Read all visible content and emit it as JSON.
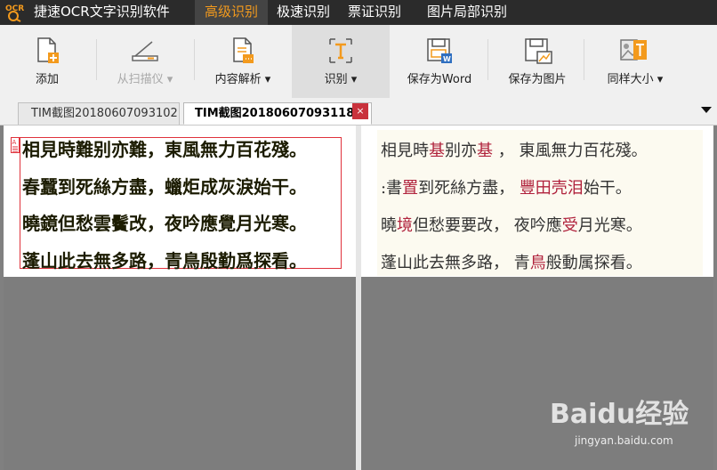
{
  "app": {
    "title": "捷速OCR文字识别软件",
    "logo_text": "OCR"
  },
  "menu_tabs": [
    {
      "label": "高级识别",
      "active": true
    },
    {
      "label": "极速识别",
      "active": false
    },
    {
      "label": "票证识别",
      "active": false
    },
    {
      "label": "图片局部识别",
      "active": false
    }
  ],
  "toolbar": {
    "add": "添加",
    "scan": "从扫描仪",
    "parse": "内容解析",
    "recognize": "识别",
    "save_word": "保存为Word",
    "save_image": "保存为图片",
    "same_size": "同样大小"
  },
  "doc_tabs": [
    {
      "label": "TIM截图20180607093102",
      "active": false
    },
    {
      "label": "TIM截图20180607093118",
      "active": true
    }
  ],
  "tab_close": "×",
  "source_marker": "A",
  "source_text": [
    "相見時難别亦難，東風無力百花殘。",
    "春蠶到死絲方盡，蠟炬成灰淚始干。",
    "曉鏡但愁雲鬢改，夜吟應覺月光寒。",
    "蓬山此去無多路，青鳥殷勤爲探看。"
  ],
  "result_text": [
    [
      {
        "t": "相見時"
      },
      {
        "t": "基",
        "h": true
      },
      {
        "t": "别亦"
      },
      {
        "t": "基",
        "h": true
      },
      {
        "t": " ， 東風無力百花殘。"
      }
    ],
    [
      {
        "t": ":書"
      },
      {
        "t": "置",
        "h": true
      },
      {
        "t": "到死絲方盡， "
      },
      {
        "t": "豐田壳泪",
        "h": true
      },
      {
        "t": "始干。"
      }
    ],
    [
      {
        "t": "曉"
      },
      {
        "t": "境",
        "h": true
      },
      {
        "t": "但愁要要改， 夜吟應"
      },
      {
        "t": "受",
        "h": true
      },
      {
        "t": "月光寒。"
      }
    ],
    [
      {
        "t": "蓬山此去無多路， 青"
      },
      {
        "t": "鳥",
        "h": true
      },
      {
        "t": "般動属探看。"
      }
    ]
  ],
  "watermark": {
    "brand": "Baidu经验",
    "url": "jingyan.baidu.com"
  },
  "colors": {
    "accent": "#f39a1d",
    "titlebar": "#2b2b2b",
    "highlight": "#b0223c",
    "region_border": "#e0323c"
  }
}
